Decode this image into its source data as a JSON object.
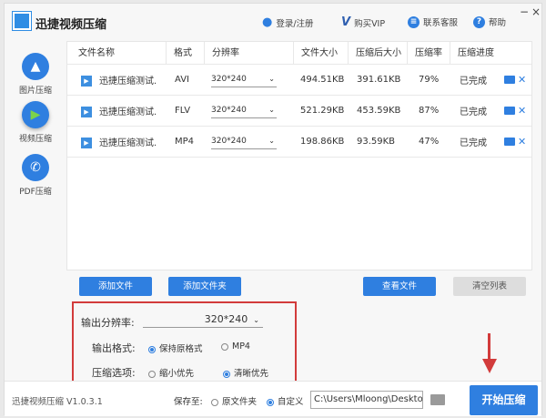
{
  "app": {
    "title": "迅捷视频压缩",
    "version": "迅捷视频压缩 V1.0.3.1"
  },
  "toolbar": {
    "login": "登录/注册",
    "vip": "购买VIP",
    "service": "联系客服",
    "help": "帮助",
    "minimize": "−",
    "close": "×"
  },
  "sidebar": {
    "items": [
      {
        "label": "图片压缩",
        "icon": "image-icon"
      },
      {
        "label": "视频压缩",
        "icon": "play-icon",
        "active": true
      },
      {
        "label": "PDF压缩",
        "icon": "pdf-icon"
      }
    ]
  },
  "table": {
    "headers": [
      "文件名称",
      "格式",
      "分辨率",
      "文件大小",
      "压缩后大小",
      "压缩率",
      "压缩进度"
    ],
    "rows": [
      {
        "name": "迅捷压缩测试.",
        "format": "AVI",
        "resolution": "320*240",
        "size": "494.51KB",
        "compressed": "391.61KB",
        "rate": "79%",
        "status": "已完成"
      },
      {
        "name": "迅捷压缩测试.",
        "format": "FLV",
        "resolution": "320*240",
        "size": "521.29KB",
        "compressed": "453.59KB",
        "rate": "87%",
        "status": "已完成"
      },
      {
        "name": "迅捷压缩测试.",
        "format": "MP4",
        "resolution": "320*240",
        "size": "198.86KB",
        "compressed": "93.59KB",
        "rate": "47%",
        "status": "已完成"
      }
    ]
  },
  "actions": {
    "add_file": "添加文件",
    "add_folder": "添加文件夹",
    "view_files": "查看文件",
    "clear_list": "清空列表"
  },
  "settings": {
    "resolution_label": "输出分辨率:",
    "resolution_value": "320*240",
    "format_label": "输出格式:",
    "format_keep": "保持原格式",
    "format_mp4": "MP4",
    "option_label": "压缩选项:",
    "option_small": "缩小优先",
    "option_clear": "清晰优先",
    "selected_format": "保持原格式",
    "selected_option": "清晰优先"
  },
  "footer": {
    "save_label": "保存至:",
    "original_folder": "原文件夹",
    "custom": "自定义",
    "path": "C:\\Users\\Mloong\\Desktop",
    "selected": "自定义",
    "start": "开始压缩"
  },
  "colors": {
    "accent": "#2f7fe0",
    "highlight": "#d23b3b"
  }
}
